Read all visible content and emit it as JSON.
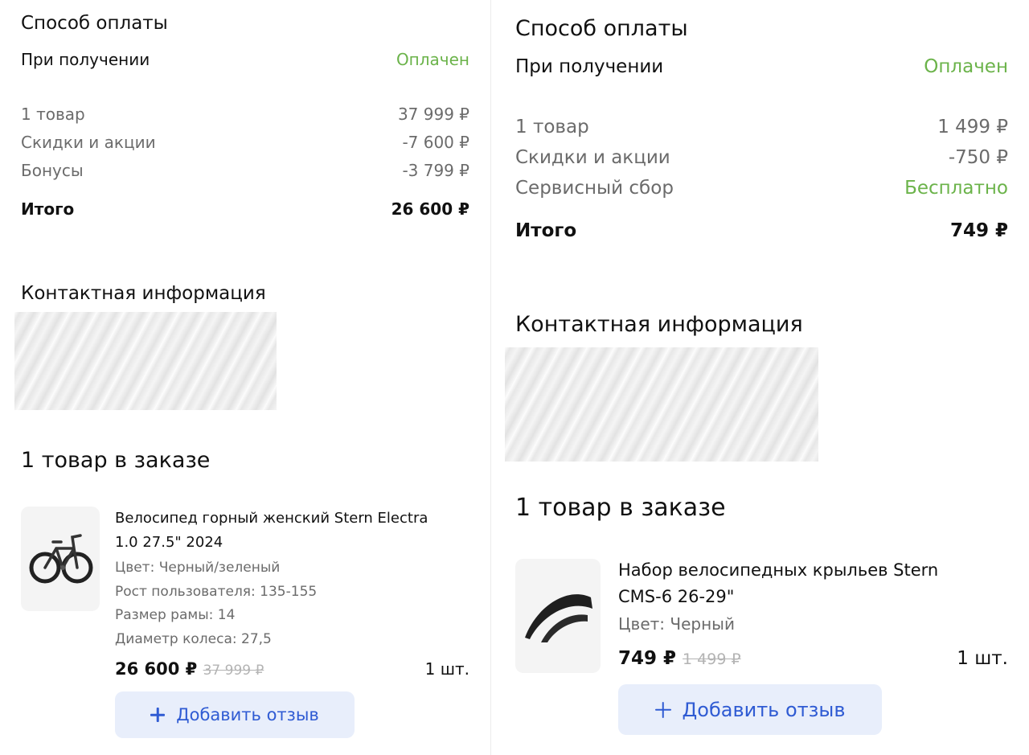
{
  "left": {
    "payment_title": "Способ оплаты",
    "payment_method": "При получении",
    "payment_status": "Оплачен",
    "rows": [
      {
        "label": "1 товар",
        "value": "37 999 ₽"
      },
      {
        "label": "Скидки и акции",
        "value": "-7 600 ₽"
      },
      {
        "label": "Бонусы",
        "value": "-3 799 ₽"
      }
    ],
    "total_label": "Итого",
    "total_value": "26 600 ₽",
    "contact_title": "Контактная информация",
    "items_title": "1 товар в заказе",
    "product": {
      "name_line1": "Велосипед горный женский Stern Electra",
      "name_line2": "1.0 27.5\" 2024",
      "attrs": [
        "Цвет: Черный/зеленый",
        "Рост пользователя: 135-155",
        "Размер рамы: 14",
        "Диаметр колеса: 27,5"
      ],
      "price": "26 600 ₽",
      "old_price": "37 999 ₽",
      "qty": "1 шт.",
      "review_label": "Добавить отзыв"
    }
  },
  "right": {
    "payment_title": "Способ оплаты",
    "payment_method": "При получении",
    "payment_status": "Оплачен",
    "rows": [
      {
        "label": "1 товар",
        "value": "1 499 ₽"
      },
      {
        "label": "Скидки и акции",
        "value": "-750 ₽"
      },
      {
        "label": "Сервисный сбор",
        "value": "Бесплатно"
      }
    ],
    "total_label": "Итого",
    "total_value": "749 ₽",
    "contact_title": "Контактная информация",
    "items_title": "1 товар в заказе",
    "product": {
      "name_line1": "Набор велосипедных крыльев Stern",
      "name_line2": "CMS-6 26-29\"",
      "attrs": [
        "Цвет: Черный"
      ],
      "price": "749 ₽",
      "old_price": "1 499 ₽",
      "qty": "1 шт.",
      "review_label": "Добавить отзыв"
    }
  },
  "colors": {
    "accent_green": "#6bb34a",
    "button_bg": "#e8eefb",
    "button_text": "#2f5bd3"
  },
  "icons": {
    "review_button": "plus-icon",
    "left_product": "bicycle-image",
    "right_product": "fenders-image"
  }
}
